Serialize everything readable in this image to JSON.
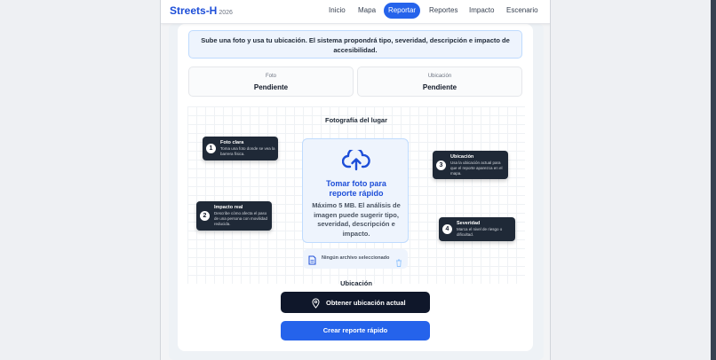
{
  "nav": {
    "brand": "Streets-H",
    "year": "2026",
    "items": [
      "Inicio",
      "Mapa",
      "Reportar",
      "Reportes",
      "Impacto",
      "Escenario"
    ],
    "active": "Reportar"
  },
  "banner": {
    "text": "Sube una foto y usa tu ubicación. El sistema propondrá tipo, severidad, descripción e impacto de accesibilidad."
  },
  "status": {
    "photo_label": "Foto",
    "photo_value": "Pendiente",
    "location_label": "Ubicación",
    "location_value": "Pendiente"
  },
  "photo_section": {
    "title": "Fotografía del lugar",
    "upload_title": "Tomar foto para reporte rápido",
    "upload_desc": "Máximo 5 MB. El análisis de imagen puede sugerir tipo, severidad, descripción e impacto.",
    "file_status": "Ningún archivo seleccionado"
  },
  "tips": [
    {
      "num": "1",
      "title": "Foto clara",
      "body": "Toma una foto donde se vea la barrera física."
    },
    {
      "num": "2",
      "title": "Impacto real",
      "body": "Describe cómo afecta el paso de una persona con movilidad reducida."
    },
    {
      "num": "3",
      "title": "Ubicación",
      "body": "Usa la ubicación actual para que el reporte aparezca en el mapa."
    },
    {
      "num": "4",
      "title": "Severidad",
      "body": "Marca el nivel de riesgo o dificultad."
    }
  ],
  "location_section": {
    "title": "Ubicación",
    "button": "Obtener ubicación actual"
  },
  "create_button": "Crear reporte rápido",
  "colors": {
    "accent": "#2563eb",
    "dark": "#0f172a",
    "tip_bg": "#1f2937"
  },
  "icons": [
    "cloud-upload-icon",
    "file-icon",
    "trash-icon",
    "map-pin-icon"
  ]
}
